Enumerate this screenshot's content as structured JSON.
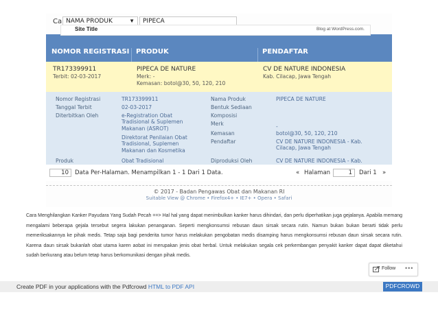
{
  "search": {
    "label": "Cari",
    "field_selected": "NAMA PRODUK",
    "query_value": "PIPECA"
  },
  "site_header": {
    "site_title": "Site Title",
    "blog_link": "Blog at WordPress.com."
  },
  "table": {
    "headers": [
      "NOMOR REGISTRASI",
      "PRODUK",
      "PENDAFTAR"
    ],
    "highlight_row": {
      "reg_number": "TR173399911",
      "issued": "Terbit: 02-03-2017",
      "product_name": "PIPECA DE NATURE",
      "brand": "Merk: -",
      "packaging": "Kemasan: botol@30, 50, 120, 210",
      "registrant": "CV DE NATURE INDONESIA",
      "registrant_location": "Kab. Cilacap, Jawa Tengah"
    },
    "detail": {
      "left_labels": [
        "Nomor Registrasi",
        "Tanggal Terbit",
        "Diterbitkan Oleh",
        "Produk"
      ],
      "left_values": {
        "reg_number": "TR173399911",
        "issued_date": "02-03-2017",
        "issuer_1": "e-Registration Obat\nTradisional & Suplemen\nMakanan (ASROT)",
        "issuer_2": "Direktorat Penilaian Obat\nTradisional, Suplemen\nMakanan dan Kosmetika",
        "product": "Obat Tradisional"
      },
      "right_labels": [
        "Nama Produk",
        "Bentuk Sediaan",
        "Komposisi",
        "Merk",
        "Kemasan",
        "Pendaftar",
        "Diproduksi Oleh"
      ],
      "right_values": {
        "product_name": "PIPECA DE NATURE",
        "brand": "-",
        "packaging": "botol@30, 50, 120, 210",
        "registrant": "CV DE NATURE INDONESIA - Kab.\nCilacap, Jawa Tengah",
        "produced_by": "CV DE NATURE INDONESIA - Kab.\nCilacap, Jawa Tengah"
      }
    }
  },
  "pager": {
    "per_page": "10",
    "summary": "Data Per-Halaman. Menampilkan 1 - 1 Dari 1 Data.",
    "prev": "«",
    "halaman_label": "Halaman",
    "page_input": "1",
    "of_label": "Dari 1",
    "next": "»"
  },
  "screenshot_footer": {
    "line1": "© 2017 - Badan Pengawas Obat dan Makanan RI",
    "line2": "Suitable View @ Chrome • Firefox4+ • IE7+ • Opera • Safari"
  },
  "article": {
    "paragraph": "Cara Menghilangkan Kanker Payudara Yang Sudah Pecah ==> Hal hal yang dapat menimbulkan kanker harus dihindari, dan perlu diperhatikan juga gejalanya. Apabila memang mengalami beberapa gejala tersebut segera lakukan penanganan. Seperti mengkonsumsi rebusan daun sirsak secara rutin. Namun bukan bukan berarti tidak perlu memeriksakannya ke pihak medis. Tetap saja bagi penderita tumor harus melakukan pengobatan medis disamping harus mengkonsumsi rebusan daun sirsak secara rutin. Karena daun sirsak bukanlah obat utama karen aobat ini merupakan jenis obat herbal. Untuk melakukan segala cek perkembangan penyakit kanker dapat dapat diketahui sudah berkurang atau belum tetap harus berkomunikasi dengan pihak medis."
  },
  "follow_widget": {
    "label": "Follow",
    "more": "•••",
    "icon": "follow-icon"
  },
  "pdfcrowd_bar": {
    "text": "Create PDF in your applications with the Pdfcrowd",
    "link": "HTML to PDF API",
    "button": "PDFCROWD"
  },
  "colors": {
    "table_header": "#5b87bf",
    "highlight_row": "#fff8c4",
    "detail_bg": "#dde8f3",
    "pdf_button": "#3c78c3"
  }
}
